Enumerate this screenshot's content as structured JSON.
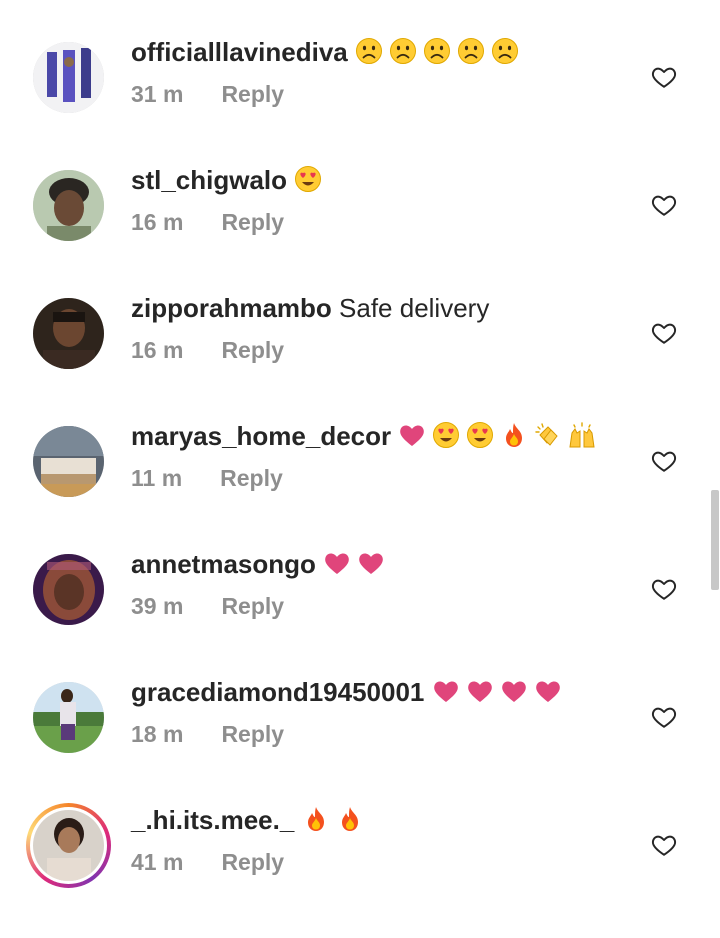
{
  "comments": [
    {
      "username": "officialllavinediva",
      "text": "",
      "emojis": [
        "sad-face",
        "sad-face",
        "sad-face",
        "sad-face",
        "sad-face"
      ],
      "time": "31 m",
      "reply": "Reply"
    },
    {
      "username": "stl_chigwalo",
      "text": "",
      "emojis": [
        "heart-eyes"
      ],
      "time": "16 m",
      "reply": "Reply"
    },
    {
      "username": "zipporahmambo",
      "text": "Safe delivery",
      "emojis": [],
      "time": "16 m",
      "reply": "Reply"
    },
    {
      "username": "maryas_home_decor",
      "text": "",
      "emojis": [
        "heart",
        "heart-eyes",
        "heart-eyes",
        "fire",
        "clapping-hands",
        "raised-hands"
      ],
      "time": "11 m",
      "reply": "Reply"
    },
    {
      "username": "annetmasongo",
      "text": "",
      "emojis": [
        "heart",
        "heart"
      ],
      "time": "39 m",
      "reply": "Reply"
    },
    {
      "username": "gracediamond19450001",
      "text": "",
      "emojis": [
        "heart",
        "heart",
        "heart",
        "heart"
      ],
      "time": "18 m",
      "reply": "Reply"
    },
    {
      "username": "_.hi.its.mee._",
      "text": "",
      "emojis": [
        "fire",
        "fire"
      ],
      "time": "41 m",
      "reply": "Reply"
    }
  ],
  "colors": {
    "text": "#262626",
    "meta": "#8e8e8e",
    "heart": "#e0457b",
    "background": "#ffffff"
  }
}
